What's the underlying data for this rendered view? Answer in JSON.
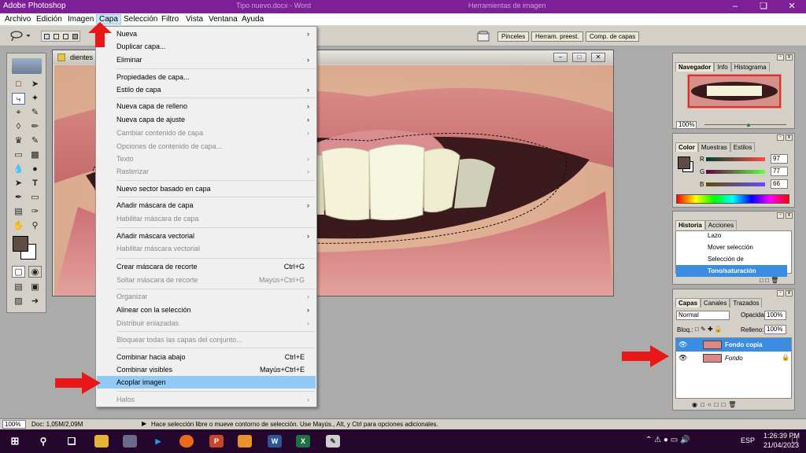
{
  "app_title": "Adobe Photoshop",
  "title_ghost": [
    "Tipo nuevo.docx - Word",
    "Herramientas de imagen"
  ],
  "menubar": [
    "Archivo",
    "Edición",
    "Imagen",
    "Capa",
    "Selección",
    "Filtro",
    "Vista",
    "Ventana",
    "Ayuda"
  ],
  "options_tabs": [
    "Pinceles",
    "Herram. preest.",
    "Comp. de capas"
  ],
  "document": {
    "title": "dientes b"
  },
  "capa_menu": [
    {
      "label": "Nueva",
      "shortcut": "",
      "submenu": true,
      "disabled": false
    },
    {
      "label": "Duplicar capa...",
      "shortcut": "",
      "submenu": false,
      "disabled": false
    },
    {
      "label": "Eliminar",
      "shortcut": "",
      "submenu": true,
      "disabled": false
    },
    {
      "label": "Propiedades de capa...",
      "shortcut": "",
      "submenu": false,
      "disabled": false
    },
    {
      "label": "Estilo de capa",
      "shortcut": "",
      "submenu": true,
      "disabled": false
    },
    {
      "label": "Nueva capa de relleno",
      "shortcut": "",
      "submenu": true,
      "disabled": false
    },
    {
      "label": "Nueva capa de ajuste",
      "shortcut": "",
      "submenu": true,
      "disabled": false
    },
    {
      "label": "Cambiar contenido de capa",
      "shortcut": "",
      "submenu": true,
      "disabled": true
    },
    {
      "label": "Opciones de contenido de capa...",
      "shortcut": "",
      "submenu": false,
      "disabled": true
    },
    {
      "label": "Texto",
      "shortcut": "",
      "submenu": true,
      "disabled": true
    },
    {
      "label": "Rasterizar",
      "shortcut": "",
      "submenu": true,
      "disabled": true
    },
    {
      "label": "Nuevo sector basado en capa",
      "shortcut": "",
      "submenu": false,
      "disabled": false
    },
    {
      "label": "Añadir máscara de capa",
      "shortcut": "",
      "submenu": true,
      "disabled": false
    },
    {
      "label": "Habilitar máscara de capa",
      "shortcut": "",
      "submenu": false,
      "disabled": true
    },
    {
      "label": "Añadir máscara vectorial",
      "shortcut": "",
      "submenu": true,
      "disabled": false
    },
    {
      "label": "Habilitar máscara vectorial",
      "shortcut": "",
      "submenu": false,
      "disabled": true
    },
    {
      "label": "Crear máscara de recorte",
      "shortcut": "Ctrl+G",
      "submenu": false,
      "disabled": false
    },
    {
      "label": "Soltar máscara de recorte",
      "shortcut": "Mayús+Ctrl+G",
      "submenu": false,
      "disabled": true
    },
    {
      "label": "Organizar",
      "shortcut": "",
      "submenu": true,
      "disabled": true
    },
    {
      "label": "Alinear con la selección",
      "shortcut": "",
      "submenu": true,
      "disabled": false
    },
    {
      "label": "Distribuir enlazadas",
      "shortcut": "",
      "submenu": true,
      "disabled": true
    },
    {
      "label": "Bloquear todas las capas del conjunto...",
      "shortcut": "",
      "submenu": false,
      "disabled": true
    },
    {
      "label": "Combinar hacia abajo",
      "shortcut": "Ctrl+E",
      "submenu": false,
      "disabled": false
    },
    {
      "label": "Combinar visibles",
      "shortcut": "Mayús+Ctrl+E",
      "submenu": false,
      "disabled": false
    },
    {
      "label": "Acoplar imagen",
      "shortcut": "",
      "submenu": false,
      "disabled": false,
      "highlighted": true
    },
    {
      "label": "Halos",
      "shortcut": "",
      "submenu": true,
      "disabled": true
    }
  ],
  "navigator": {
    "tabs": [
      "Navegador",
      "Info",
      "Histograma"
    ],
    "zoom": "100%"
  },
  "color": {
    "tabs": [
      "Color",
      "Muestras",
      "Estilos"
    ],
    "r": "97",
    "g": "77",
    "b": "66",
    "r_label": "R",
    "g_label": "G",
    "b_label": "B"
  },
  "history": {
    "tabs": [
      "Historia",
      "Acciones"
    ],
    "items": [
      "Lazo",
      "Mover selección",
      "Selección de transformació...",
      "Tono/saturación"
    ]
  },
  "layers": {
    "tabs": [
      "Capas",
      "Canales",
      "Trazados"
    ],
    "blend_mode": "Normal",
    "opacity_label": "Opacidad:",
    "opacity": "100%",
    "lock_label": "Bloq.:",
    "fill_label": "Relleno:",
    "fill": "100%",
    "items": [
      "Fondo copia",
      "Fondo"
    ]
  },
  "status": {
    "zoom": "100%",
    "doc": "Doc: 1,05M/2,09M",
    "hint": "Hace selección libre o mueve contorno de selección. Use Mayús., Alt, y Ctrl para opciones adicionales."
  },
  "taskbar": {
    "time": "1:26:39 PM",
    "date": "21/04/2023",
    "lang": "ESP"
  }
}
